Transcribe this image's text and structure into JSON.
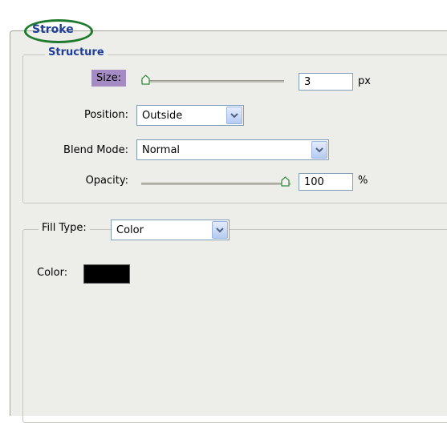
{
  "panel": {
    "title": "Stroke"
  },
  "structure": {
    "legend": "Structure",
    "size": {
      "label": "Size:",
      "value": "3",
      "unit": "px",
      "slider_fraction": 0.0
    },
    "position": {
      "label": "Position:",
      "value": "Outside"
    },
    "blend_mode": {
      "label": "Blend Mode:",
      "value": "Normal"
    },
    "opacity": {
      "label": "Opacity:",
      "value": "100",
      "unit": "%",
      "slider_fraction": 1.0
    }
  },
  "fill": {
    "type_label": "Fill Type:",
    "type_value": "Color",
    "color_label": "Color:",
    "color": "#000000"
  },
  "colors": {
    "title_highlight": "#1e7a2e",
    "heading": "#1f3f9a",
    "size_highlight": "#a48bc4",
    "panel_bg": "#ededea"
  }
}
